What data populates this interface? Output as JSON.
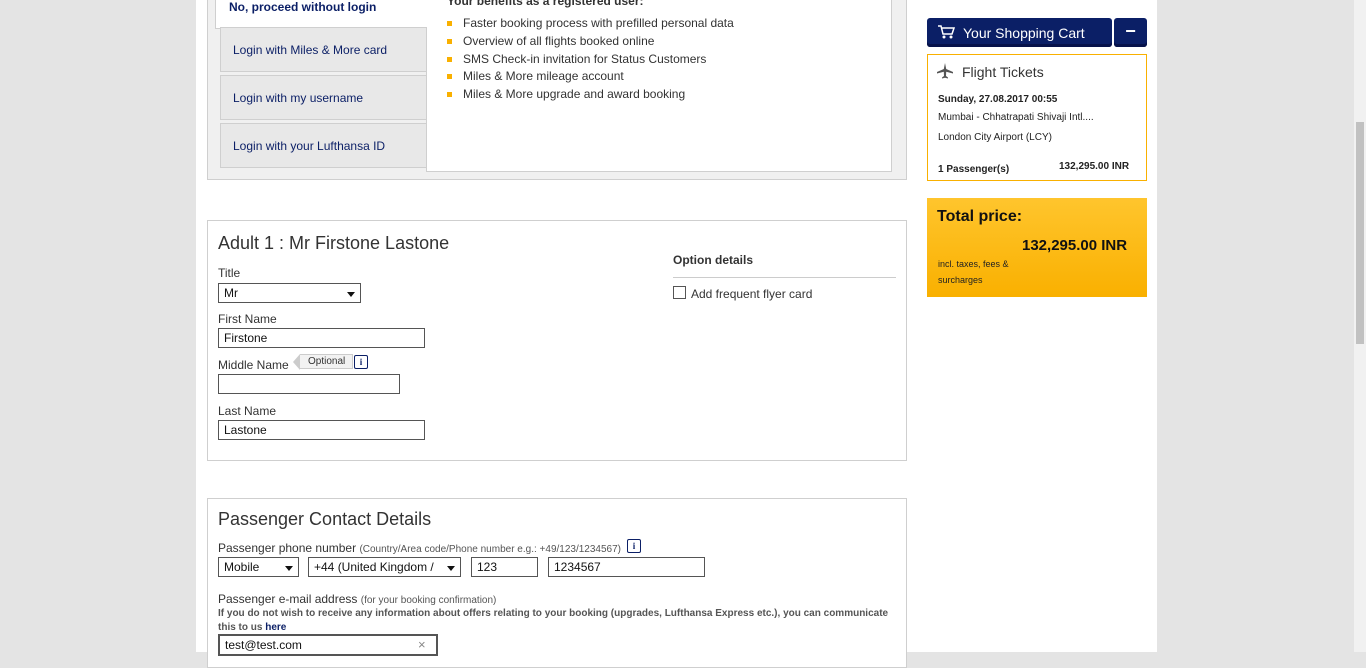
{
  "login": {
    "active_tab": "No, proceed without login",
    "tabs": [
      {
        "label": "Login with Miles & More card"
      },
      {
        "label": "Login with my username"
      },
      {
        "label": "Login with your Lufthansa ID"
      }
    ],
    "benefits_title": "Your benefits as a registered user:",
    "benefits": [
      "Faster booking process with prefilled personal data",
      "Overview of all flights booked online",
      "SMS Check-in invitation for Status Customers",
      "Miles & More mileage account",
      "Miles & More upgrade and award booking"
    ]
  },
  "passenger": {
    "heading": "Adult 1 : Mr Firstone Lastone",
    "title_label": "Title",
    "title_value": "Mr",
    "first_name_label": "First Name",
    "first_name_value": "Firstone",
    "middle_name_label": "Middle Name",
    "optional_tag": "Optional",
    "middle_name_value": "",
    "last_name_label": "Last Name",
    "last_name_value": "Lastone",
    "option_details_title": "Option details",
    "frequent_flyer_label": "Add frequent flyer card"
  },
  "contact": {
    "heading": "Passenger Contact Details",
    "phone_label": "Passenger phone number",
    "phone_hint": "(Country/Area code/Phone number e.g.: +49/123/1234567)",
    "phone_type": "Mobile",
    "country_code": "+44 (United Kingdom /",
    "area_code": "123",
    "phone_number": "1234567",
    "email_label": "Passenger e-mail address",
    "email_hint": "(for your booking confirmation)",
    "email_note": "If you do not wish to receive any information about offers relating to your booking (upgrades, Lufthansa Express etc.), you can communicate this to us",
    "email_note_link": "here",
    "email_value": "test@test.com"
  },
  "cart": {
    "button_label": "Your Shopping Cart",
    "collapse_label": "−",
    "section_title": "Flight Tickets",
    "date": "Sunday, 27.08.2017 00:55",
    "origin": "Mumbai - Chhatrapati Shivaji Intl....",
    "destination": "London City Airport (LCY)",
    "passengers": "1 Passenger(s)",
    "price": "132,295.00 INR",
    "total_label": "Total price:",
    "total_value": "132,295.00 INR",
    "total_note": "incl. taxes, fees & surcharges"
  },
  "colors": {
    "brand_blue": "#0b1f66",
    "accent_yellow": "#f9b000"
  }
}
